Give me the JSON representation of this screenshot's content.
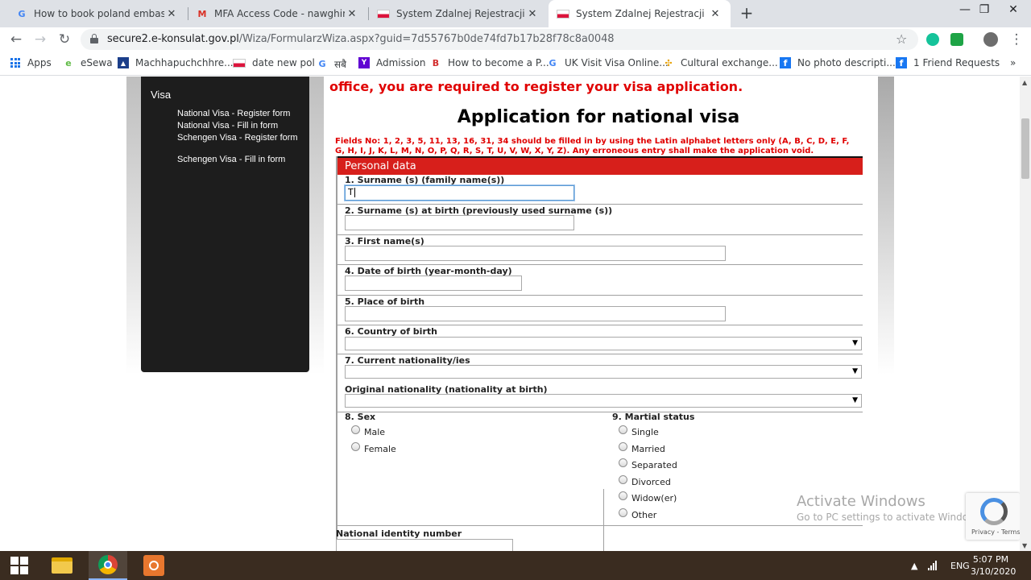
{
  "browser": {
    "tabs": [
      {
        "title": "How to book poland embassy ap",
        "favicon": "google-g",
        "active": false
      },
      {
        "title": "MFA Access Code - nawghiraj@g",
        "favicon": "gmail-m",
        "active": false
      },
      {
        "title": "System Zdalnej Rejestracji",
        "favicon": "poland-flag",
        "active": false
      },
      {
        "title": "System Zdalnej Rejestracji",
        "favicon": "poland-flag",
        "active": true
      }
    ],
    "new_tab": "+",
    "window_controls": {
      "minimize": "—",
      "maximize": "❐",
      "close": "✕"
    },
    "url_host": "secure2.e-konsulat.gov.pl",
    "url_path": "/Wiza/FormularzWiza.aspx?guid=7d55767b0de74fd7b17b28f78c8a0048",
    "bookmarks": [
      {
        "label": "Apps",
        "icon": "apps-grid-icon"
      },
      {
        "label": "eSewa",
        "icon": "esewa-icon"
      },
      {
        "label": "Machhapuchchhre...",
        "icon": "bank-icon"
      },
      {
        "label": "date new pol",
        "icon": "poland-flag-icon"
      },
      {
        "label": "सबै",
        "icon": "google-icon"
      },
      {
        "label": "Admission",
        "icon": "yahoo-icon"
      },
      {
        "label": "How to become a P...",
        "icon": "bookmark-red-icon"
      },
      {
        "label": "UK Visit Visa Online...",
        "icon": "google-icon"
      },
      {
        "label": "Cultural exchange...",
        "icon": "pinwheel-icon"
      },
      {
        "label": "No photo descripti...",
        "icon": "facebook-icon"
      },
      {
        "label": "1 Friend Requests",
        "icon": "facebook-icon"
      }
    ],
    "bookmarks_overflow": "»"
  },
  "sidebar": {
    "title": "Visa",
    "links": [
      "National Visa - Register form",
      "National Visa - Fill in form",
      "Schengen Visa - Register form",
      "Schengen Visa - Fill in form"
    ]
  },
  "page": {
    "notice": "office, you are required to register your visa application.",
    "title": "Application for national visa",
    "fields_note": "Fields No: 1, 2, 3, 5, 11, 13, 16, 31, 34 should be filled in by using the Latin alphabet letters only (A, B, C, D, E, F, G, H, I, J, K, L, M, N, O, P, Q, R, S, T, U, V, W, X, Y, Z). Any erroneous entry shall make the application void.",
    "section": "Personal data",
    "fields": {
      "surname": {
        "label": "1. Surname (s) (family name(s))",
        "value": "T"
      },
      "surname_birth": {
        "label": "2. Surname (s) at birth (previously used surname (s))",
        "value": ""
      },
      "first_name": {
        "label": "3. First name(s)",
        "value": ""
      },
      "dob": {
        "label": "4. Date of birth (year-month-day)",
        "value": ""
      },
      "place_birth": {
        "label": "5. Place of birth",
        "value": ""
      },
      "country_birth": {
        "label": "6. Country of birth",
        "value": ""
      },
      "nationality": {
        "label": "7. Current nationality/ies",
        "value": ""
      },
      "original_nationality": {
        "label": "Original nationality (nationality at birth)",
        "value": ""
      },
      "sex": {
        "label": "8. Sex",
        "options": [
          "Male",
          "Female"
        ]
      },
      "marital": {
        "label": "9. Martial status",
        "options": [
          "Single",
          "Married",
          "Separated",
          "Divorced",
          "Widow(er)",
          "Other"
        ]
      },
      "national_id": {
        "label": "National identity number",
        "value": ""
      }
    }
  },
  "overlay": {
    "activate_title": "Activate Windows",
    "activate_sub": "Go to PC settings to activate Windows.",
    "recaptcha_terms": "Privacy - Terms"
  },
  "taskbar": {
    "language": "ENG",
    "time": "5:07 PM",
    "date": "3/10/2020"
  },
  "colors": {
    "accent_red": "#d71f1b",
    "notice_red": "#e00000",
    "sidebar_bg": "#1d1d1d"
  }
}
